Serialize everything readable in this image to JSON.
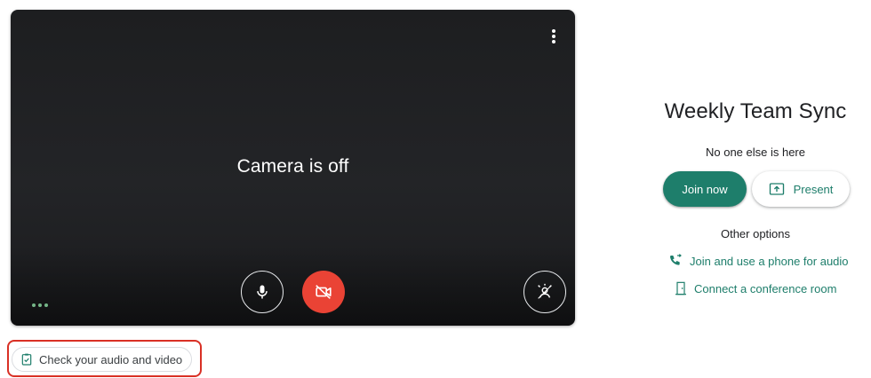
{
  "preview": {
    "status_text": "Camera is off",
    "more_options_icon": "more-vert-icon",
    "microphone_icon": "mic-icon",
    "camera_icon": "videocam-off-icon",
    "effects_icon": "visual-effects-icon"
  },
  "check": {
    "label": "Check your audio and video",
    "icon": "clipboard-check-icon"
  },
  "meeting": {
    "title": "Weekly Team Sync",
    "status": "No one else is here",
    "join_label": "Join now",
    "present_label": "Present",
    "other_options_label": "Other options",
    "options": [
      {
        "label": "Join and use a phone for audio",
        "icon": "phone-forward-icon"
      },
      {
        "label": "Connect a conference room",
        "icon": "door-icon"
      }
    ]
  },
  "colors": {
    "accent": "#1e7e6b",
    "camera_off_red": "#ea4335",
    "highlight_red": "#d93025"
  }
}
